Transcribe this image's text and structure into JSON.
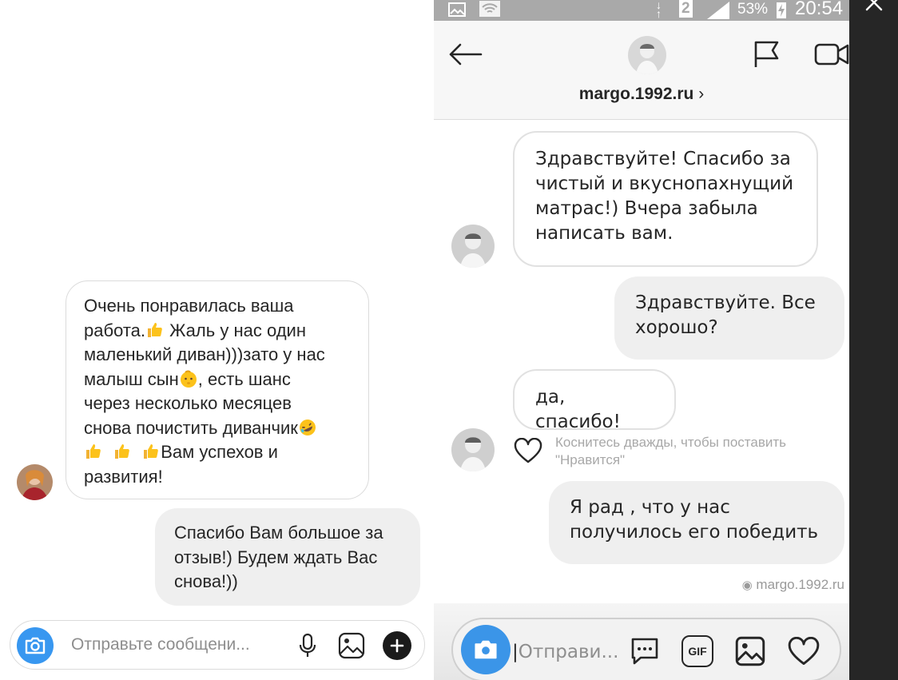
{
  "left": {
    "received_message": {
      "lines": [
        "Очень понравилась ваша",
        "работа.",
        "Жаль у нас один",
        "маленький диван)))зато у нас",
        "малыш сын",
        ", есть шанс",
        "через несколько месяцев",
        "снова почистить диванчик",
        "Вам успехов и",
        "развития!"
      ]
    },
    "sent_message": {
      "lines": [
        "Спасибо Вам большое за",
        "отзыв!) Будем ждать Вас",
        "снова!))"
      ]
    },
    "composer": {
      "placeholder": "Отправьте сообщени..."
    }
  },
  "right": {
    "status": {
      "sim": "2",
      "battery": "53%",
      "time": "20:54"
    },
    "header": {
      "username": "margo.1992.ru",
      "chevron": "›"
    },
    "messages": [
      {
        "from": "them",
        "lines": [
          "Здравствуйте! Спасибо за",
          "чистый и вкуснопахнущий",
          "матрас!) Вчера забыла",
          "написать вам."
        ]
      },
      {
        "from": "me",
        "lines": [
          "Здравствуйте. Все",
          "хорошо?"
        ]
      },
      {
        "from": "them",
        "lines": [
          "да, спасибо!"
        ]
      },
      {
        "from": "me",
        "lines": [
          "Я рад  , что у нас",
          "получилось его победить"
        ]
      }
    ],
    "like_hint": {
      "line1": "Коснитесь дважды, чтобы поставить",
      "line2": "\"Нравится\""
    },
    "seen_by": "margo.1992.ru",
    "composer": {
      "placeholder": "Отправи...",
      "gif_label": "GIF"
    }
  },
  "colors": {
    "accent": "#3897f0",
    "bubble_out": "#efefef",
    "border": "#dbdbdb",
    "status_bar": "#a9a9a9",
    "dark_strip": "#262626"
  },
  "icons": [
    "thumbs-up-icon",
    "baby-face-icon",
    "rofl-icon",
    "camera-icon",
    "microphone-icon",
    "gallery-icon",
    "plus-icon",
    "back-arrow-icon",
    "flag-icon",
    "video-call-icon",
    "heart-icon",
    "eye-icon",
    "chat-bubble-icon",
    "gif-icon",
    "close-icon"
  ]
}
